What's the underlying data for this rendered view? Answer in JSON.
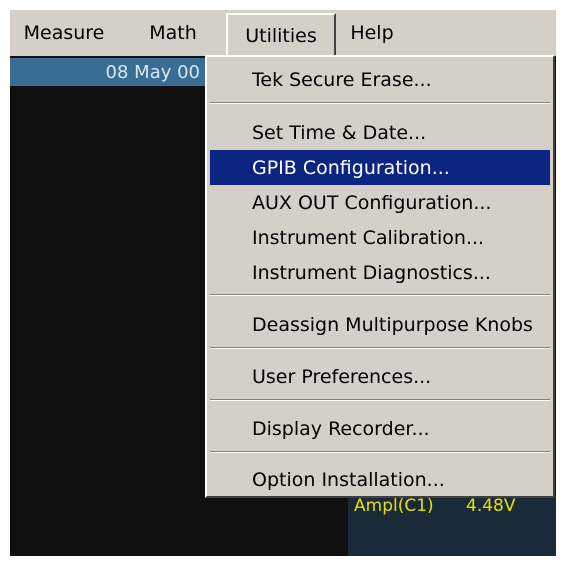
{
  "menubar": {
    "items": [
      {
        "label": "Measure"
      },
      {
        "label": "Math"
      },
      {
        "label": "Utilities"
      },
      {
        "label": "Help"
      }
    ]
  },
  "screen": {
    "date": "08 May 00",
    "measurement": {
      "label": "Ampl(C1)",
      "value": "4.48V"
    }
  },
  "utilities_menu": {
    "items": [
      {
        "label": "Tek Secure Erase..."
      },
      {
        "label": "Set Time & Date..."
      },
      {
        "label": "GPIB Configuration...",
        "selected": true
      },
      {
        "label": "AUX OUT Configuration..."
      },
      {
        "label": "Instrument Calibration..."
      },
      {
        "label": "Instrument Diagnostics..."
      },
      {
        "label": "Deassign Multipurpose Knobs"
      },
      {
        "label": "User Preferences..."
      },
      {
        "label": "Display Recorder..."
      },
      {
        "label": "Option Installation..."
      }
    ]
  },
  "colors": {
    "menu_face": "#d4d0c8",
    "selection": "#0a2480",
    "date_bar": "#3a6d94",
    "measurement_text": "#e8e000"
  }
}
